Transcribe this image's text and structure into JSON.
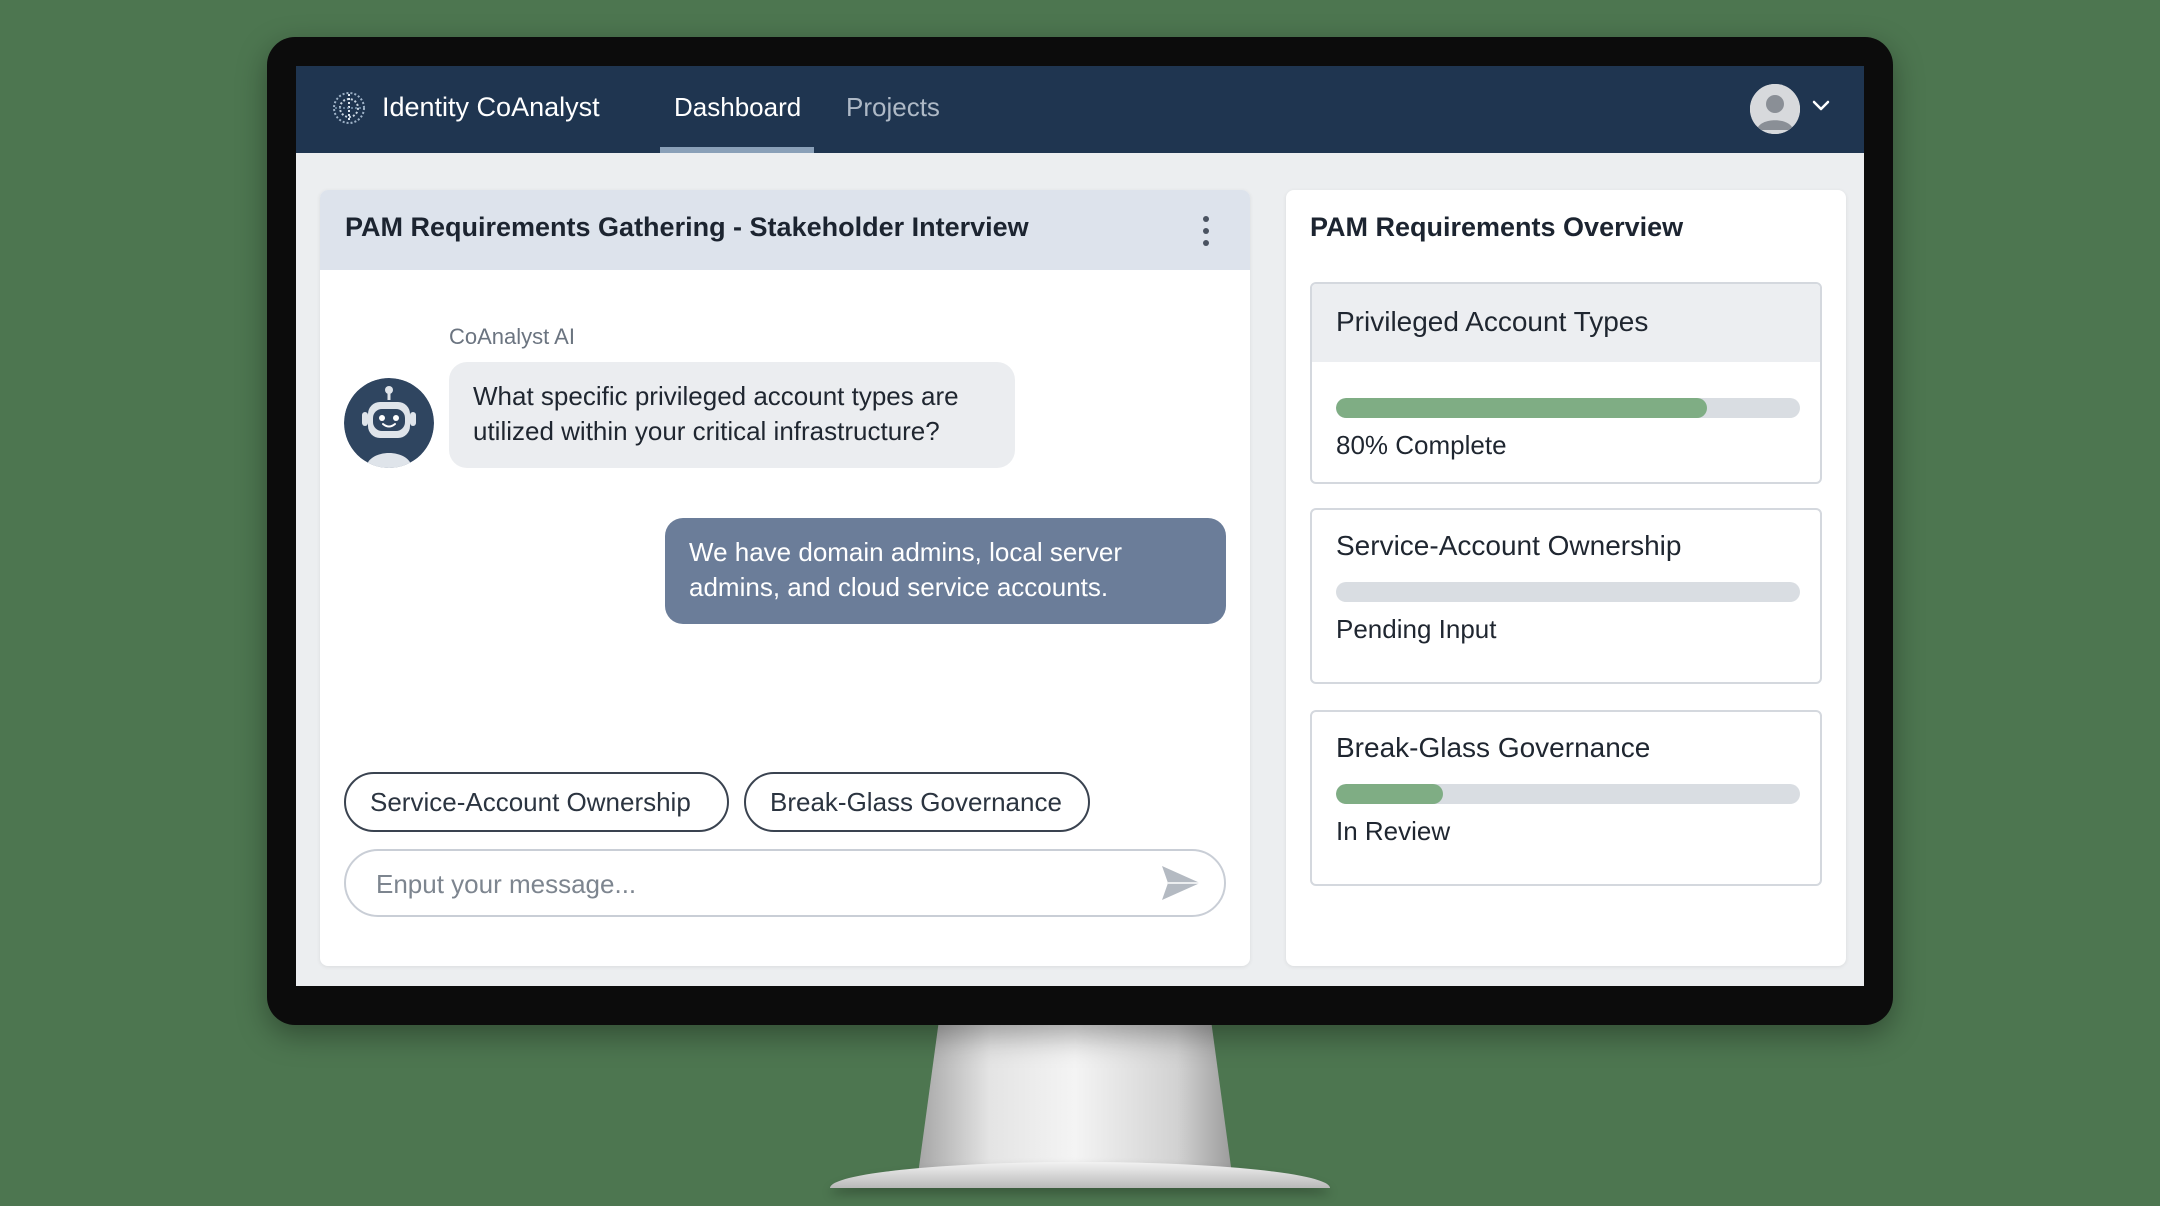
{
  "app": {
    "brand": "Identity CoAnalyst",
    "nav": [
      {
        "label": "Dashboard",
        "active": true
      },
      {
        "label": "Projects",
        "active": false
      }
    ],
    "icons": {
      "logo": "globe-logo-icon",
      "user": "user-avatar-icon",
      "chevron": "chevron-down-icon"
    }
  },
  "chat": {
    "title": "PAM Requirements Gathering - Stakeholder Interview",
    "menu_icon": "more-vertical-icon",
    "ai_name": "CoAnalyst AI",
    "messages": [
      {
        "from": "ai",
        "text": "What specific privileged account types are utilized within your critical infrastructure?"
      },
      {
        "from": "user",
        "text": "We have domain admins, local server admins, and cloud service accounts."
      }
    ],
    "suggestions": [
      "Service-Account Ownership",
      "Break-Glass Governance"
    ],
    "input": {
      "placeholder": "Enput your message...",
      "value": ""
    },
    "send_icon": "send-icon"
  },
  "overview": {
    "title": "PAM Requirements Overview",
    "items": [
      {
        "title": "Privileged Account Types",
        "progress": 0.8,
        "status": "80% Complete"
      },
      {
        "title": "Service-Account Ownership",
        "progress": 0.0,
        "status": "Pending Input"
      },
      {
        "title": "Break-Glass Governance",
        "progress": 0.23,
        "status": "In Review"
      }
    ]
  },
  "colors": {
    "nav_bg": "#1f3550",
    "user_bubble": "#6b7d99",
    "progress_fill": "#7fad84",
    "background": "#4d7650"
  }
}
